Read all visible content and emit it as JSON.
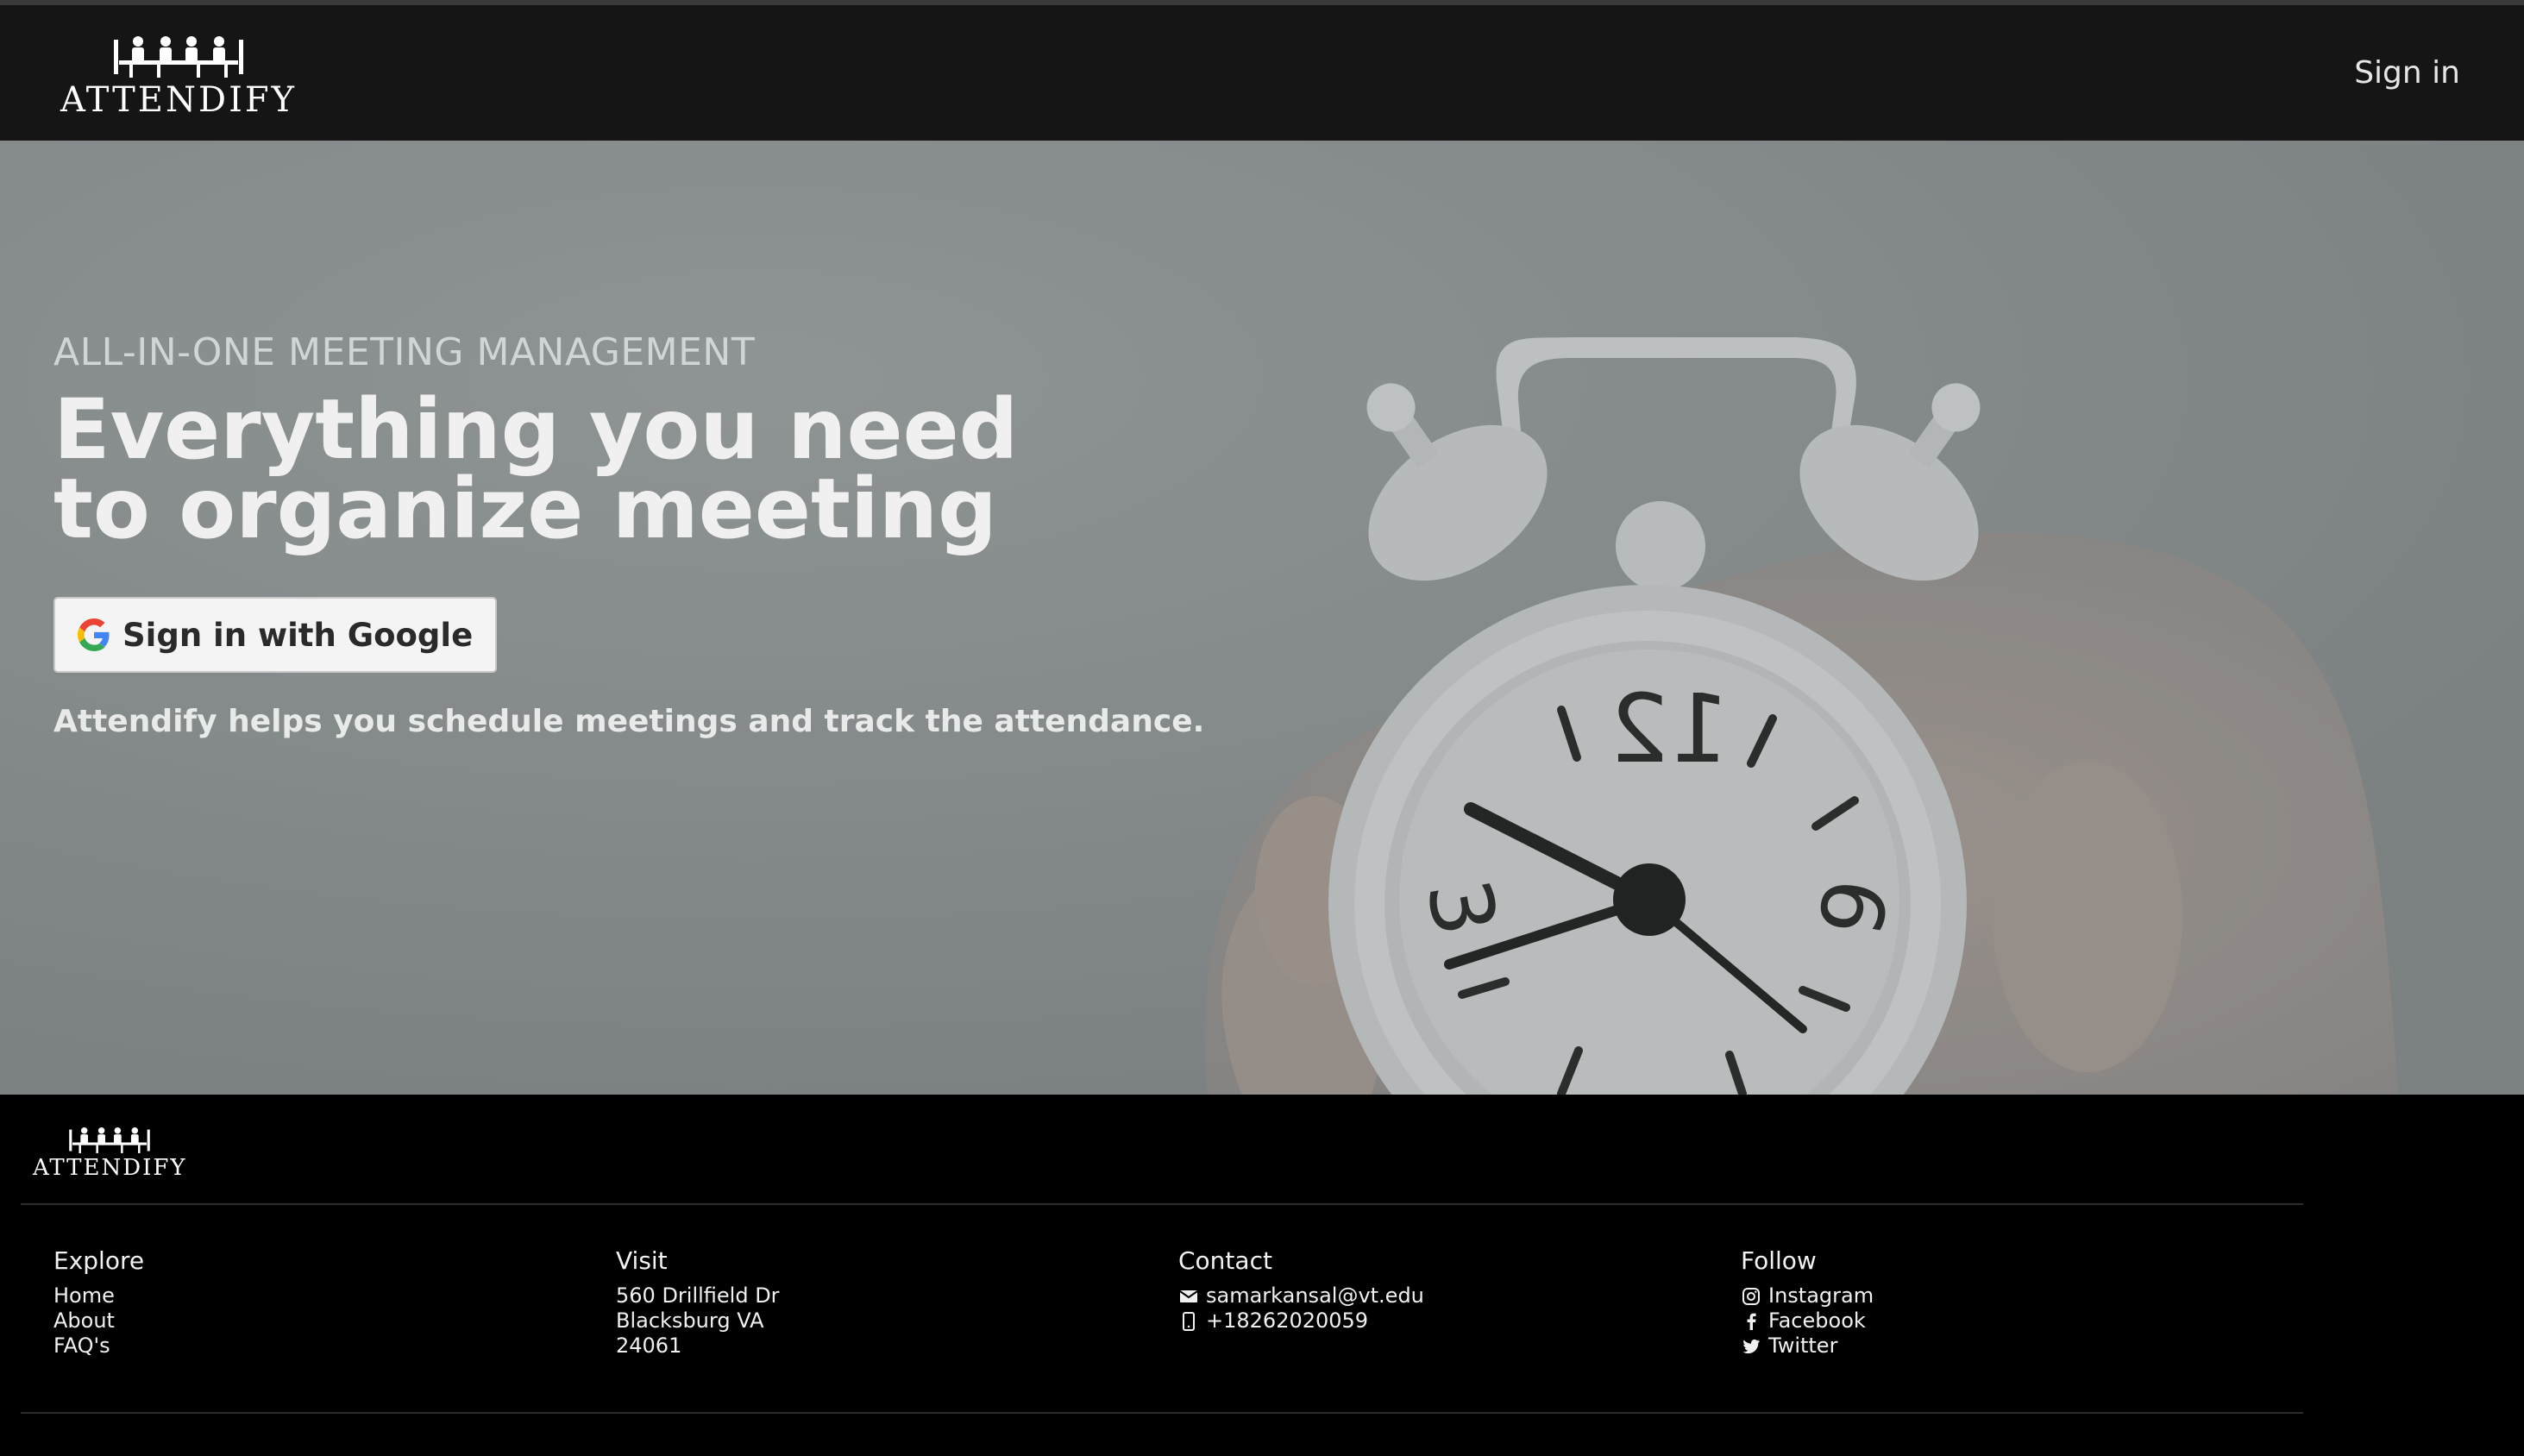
{
  "header": {
    "logo_text": "ATTENDIFY",
    "signin_label": "Sign in"
  },
  "hero": {
    "eyebrow": "ALL-IN-ONE MEETING MANAGEMENT",
    "headline": "Everything you need to organize meeting",
    "google_button_label": "Sign in with Google",
    "tagline": "Attendify helps you schedule meetings and track the attendance.",
    "clock_numerals": [
      "12",
      "3",
      "9"
    ]
  },
  "footer": {
    "logo_text": "ATTENDIFY",
    "explore": {
      "title": "Explore",
      "links": [
        "Home",
        "About",
        "FAQ's"
      ]
    },
    "visit": {
      "title": "Visit",
      "lines": [
        "560 Drillfield Dr",
        "Blacksburg VA",
        "24061"
      ]
    },
    "contact": {
      "title": "Contact",
      "email": "samarkansal@vt.edu",
      "phone": "+18262020059"
    },
    "follow": {
      "title": "Follow",
      "links": [
        "Instagram",
        "Facebook",
        "Twitter"
      ]
    }
  },
  "colors": {
    "header_bg": "#151515",
    "footer_bg": "#000000",
    "hero_overlay": "#84898a"
  },
  "icons": {
    "google": "google-g-icon",
    "email": "envelope-icon",
    "phone": "mobile-phone-icon",
    "instagram": "instagram-icon",
    "facebook": "facebook-icon",
    "twitter": "twitter-icon"
  }
}
